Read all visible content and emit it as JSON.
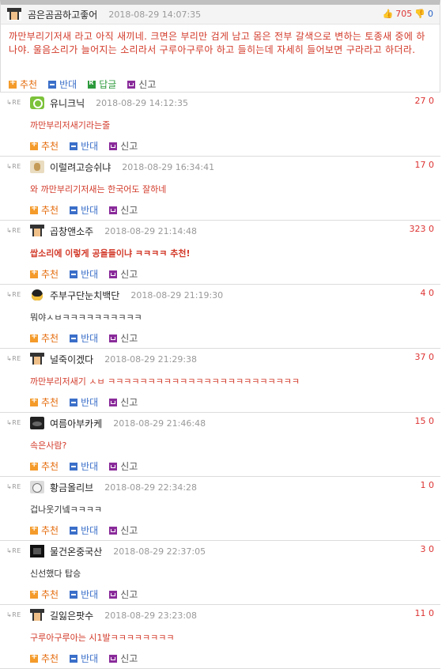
{
  "main_post": {
    "nickname": "곰은곰곰하고좋어",
    "date": "2018-08-29 14:07:35",
    "up_count": "705",
    "down_count": "0",
    "text": "까만부리기저새 라고 아직 새끼네. 크면은 부리만 검게 남고 몸은 전부 갈색으로 변하는 토종새 중에 하나야. 울음소리가 늘어지는 소리라서 구루아구루아 하고 들히는데 자세히 들어보면 구라라고 하더라."
  },
  "actions": {
    "recommend": "추천",
    "oppose": "반대",
    "reply": "답글",
    "report": "신고"
  },
  "re_label": "RE",
  "comments": [
    {
      "avatar": "green-power-icon",
      "nickname": "유니크닉",
      "date": "2018-08-29 14:12:35",
      "score": "27 0",
      "text": "까만부리저새기라는줄"
    },
    {
      "avatar": "beige-cat-icon",
      "nickname": "이럴려고승쉬냐",
      "date": "2018-08-29 16:34:41",
      "score": "17 0",
      "text": "와 까만부리기저새는 한국어도 잘하네"
    },
    {
      "avatar": "hat-man-icon",
      "nickname": "곱창앤소주",
      "date": "2018-08-29 21:14:48",
      "score": "323 0",
      "text": "쌉소리에 이렇게 공을들이냐 ㅋㅋㅋㅋ 추천!"
    },
    {
      "avatar": "penguin-icon",
      "nickname": "주부구단눈치백단",
      "date": "2018-08-29 21:19:30",
      "score": "4 0",
      "text": "뭐야ㅅㅂㅋㅋㅋㅋㅋㅋㅋㅋㅋㅋ"
    },
    {
      "avatar": "hat-man-icon",
      "nickname": "널죽이겠다",
      "date": "2018-08-29 21:29:38",
      "score": "37 0",
      "text": "까만부리저새기 ㅅㅂ ㅋㅋㅋㅋㅋㅋㅋㅋㅋㅋㅋㅋㅋㅋㅋㅋㅋㅋㅋㅋㅋㅋㅋㅋ"
    },
    {
      "avatar": "dark-photo-icon",
      "nickname": "여름아부카케",
      "date": "2018-08-29 21:46:48",
      "score": "15 0",
      "text": "속은사람?"
    },
    {
      "avatar": "gray-face-icon",
      "nickname": "황금올리브",
      "date": "2018-08-29 22:34:28",
      "score": "1 0",
      "text": "겁나웃기넼ㅋㅋㅋㅋ"
    },
    {
      "avatar": "black-pixel-icon",
      "nickname": "물건온중국산",
      "date": "2018-08-29 22:37:05",
      "score": "3 0",
      "text": "신선했다 탑승"
    },
    {
      "avatar": "hat-man-icon",
      "nickname": "길잃은팟수",
      "date": "2018-08-29 23:23:08",
      "score": "11 0",
      "text": "구루아구루아는 시1발ㅋㅋㅋㅋㅋㅋㅋㅋ"
    }
  ]
}
